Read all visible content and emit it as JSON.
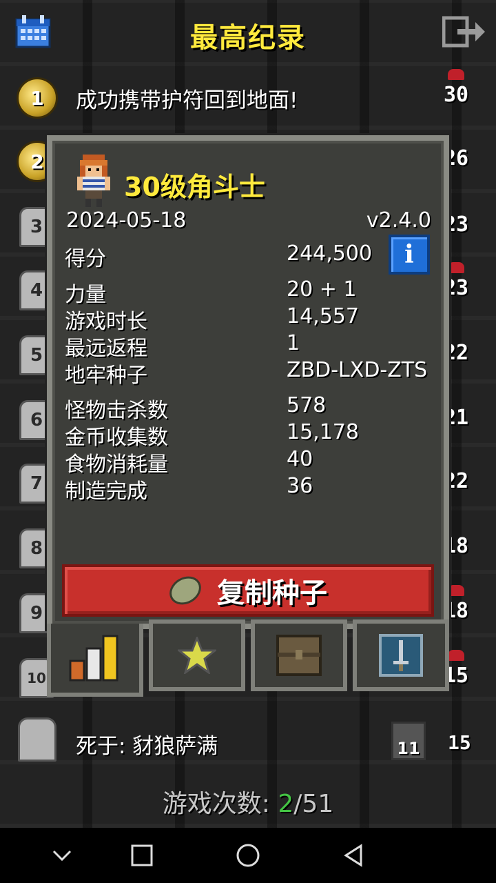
{
  "header": {
    "title": "最高纪录",
    "left_icon": "calendar-icon",
    "right_icon": "exit-icon"
  },
  "records": [
    {
      "rank": "1",
      "text": "成功携带护符回到地面!",
      "level": "30"
    },
    {
      "rank": "2",
      "level": "26"
    },
    {
      "rank": "3",
      "level": "23"
    },
    {
      "rank": "4",
      "level": "23"
    },
    {
      "rank": "5",
      "level": "22"
    },
    {
      "rank": "6",
      "level": "21"
    },
    {
      "rank": "7",
      "level": "22"
    },
    {
      "rank": "8",
      "level": "18"
    },
    {
      "rank": "9",
      "level": "18"
    },
    {
      "rank": "10",
      "level": "15"
    },
    {
      "rank": "11",
      "text": "死于: 豺狼萨满",
      "level": "15"
    }
  ],
  "popup": {
    "hero_title": "30级角斗士",
    "date": "2024-05-18",
    "version": "v2.4.0",
    "stats": [
      {
        "label": "得分",
        "value": "244,500"
      },
      {
        "label": "力量",
        "value": "20 + 1"
      },
      {
        "label": "游戏时长",
        "value": "14,557"
      },
      {
        "label": "最远返程",
        "value": "1"
      },
      {
        "label": "地牢种子",
        "value": "ZBD-LXD-ZTS"
      },
      {
        "label": "怪物击杀数",
        "value": "578"
      },
      {
        "label": "金币收集数",
        "value": "15,178"
      },
      {
        "label": "食物消耗量",
        "value": "40"
      },
      {
        "label": "制造完成",
        "value": "36"
      }
    ],
    "info_label": "i",
    "copy_button": "复制种子",
    "tabs": [
      "stats-icon",
      "badges-icon",
      "items-icon",
      "weapon-icon"
    ]
  },
  "footer": {
    "games_label": "游戏次数:",
    "games_current": "2",
    "games_total": "/51"
  },
  "colors": {
    "accent_yellow": "#ffea3d",
    "button_red": "#c8302c",
    "info_blue": "#1f6fd8",
    "green": "#44c444"
  }
}
